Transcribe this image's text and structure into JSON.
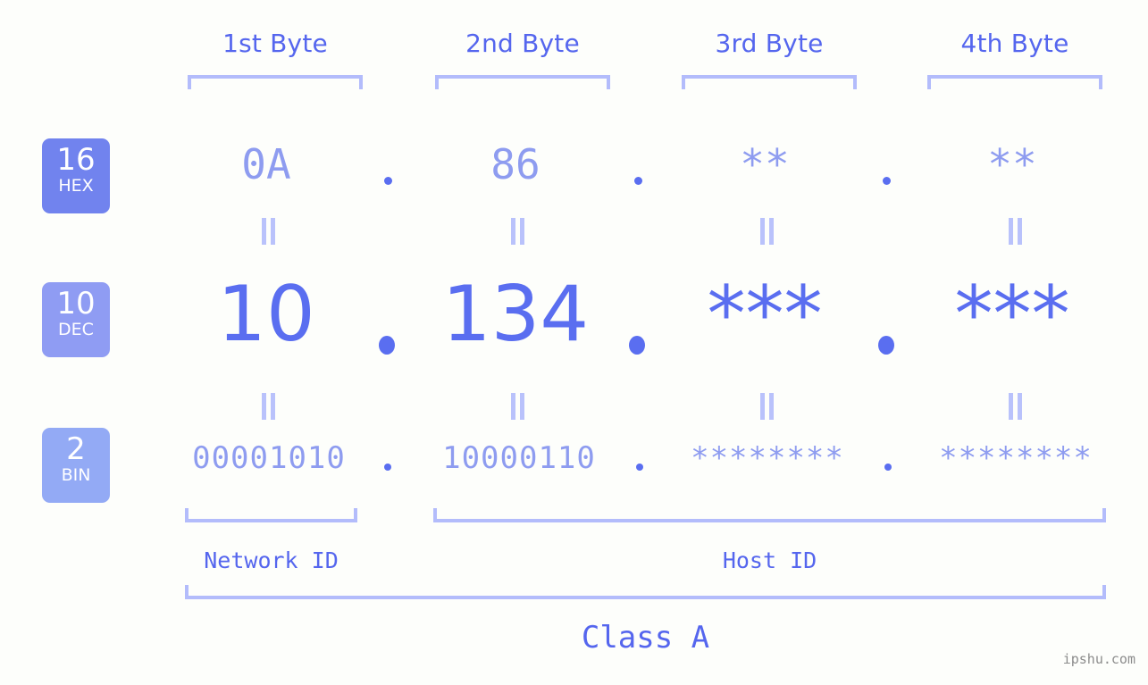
{
  "page": {
    "background_color": "#fdfefb",
    "accent_color": "#5566ee",
    "bracket_color": "#b3bcfb",
    "muted_value_color": "#8e9cf0",
    "strong_value_color": "#5a6ef0"
  },
  "byte_headers": [
    {
      "label": "1st Byte"
    },
    {
      "label": "2nd Byte"
    },
    {
      "label": "3rd Byte"
    },
    {
      "label": "4th Byte"
    }
  ],
  "bases": [
    {
      "number": "16",
      "abbr": "HEX",
      "color": "#7183ee"
    },
    {
      "number": "10",
      "abbr": "DEC",
      "color": "#8f9cf3"
    },
    {
      "number": "2",
      "abbr": "BIN",
      "color": "#93aaf5"
    }
  ],
  "rows": {
    "hex": {
      "values": [
        "0A",
        "86",
        "**",
        "**"
      ]
    },
    "dec": {
      "values": [
        "10",
        "134",
        "***",
        "***"
      ]
    },
    "bin": {
      "values": [
        "00001010",
        "10000110",
        "********",
        "********"
      ]
    }
  },
  "separator": ".",
  "equals_symbol": "=",
  "id_labels": {
    "network": "Network ID",
    "host": "Host ID"
  },
  "class_label": "Class A",
  "watermark": "ipshu.com"
}
